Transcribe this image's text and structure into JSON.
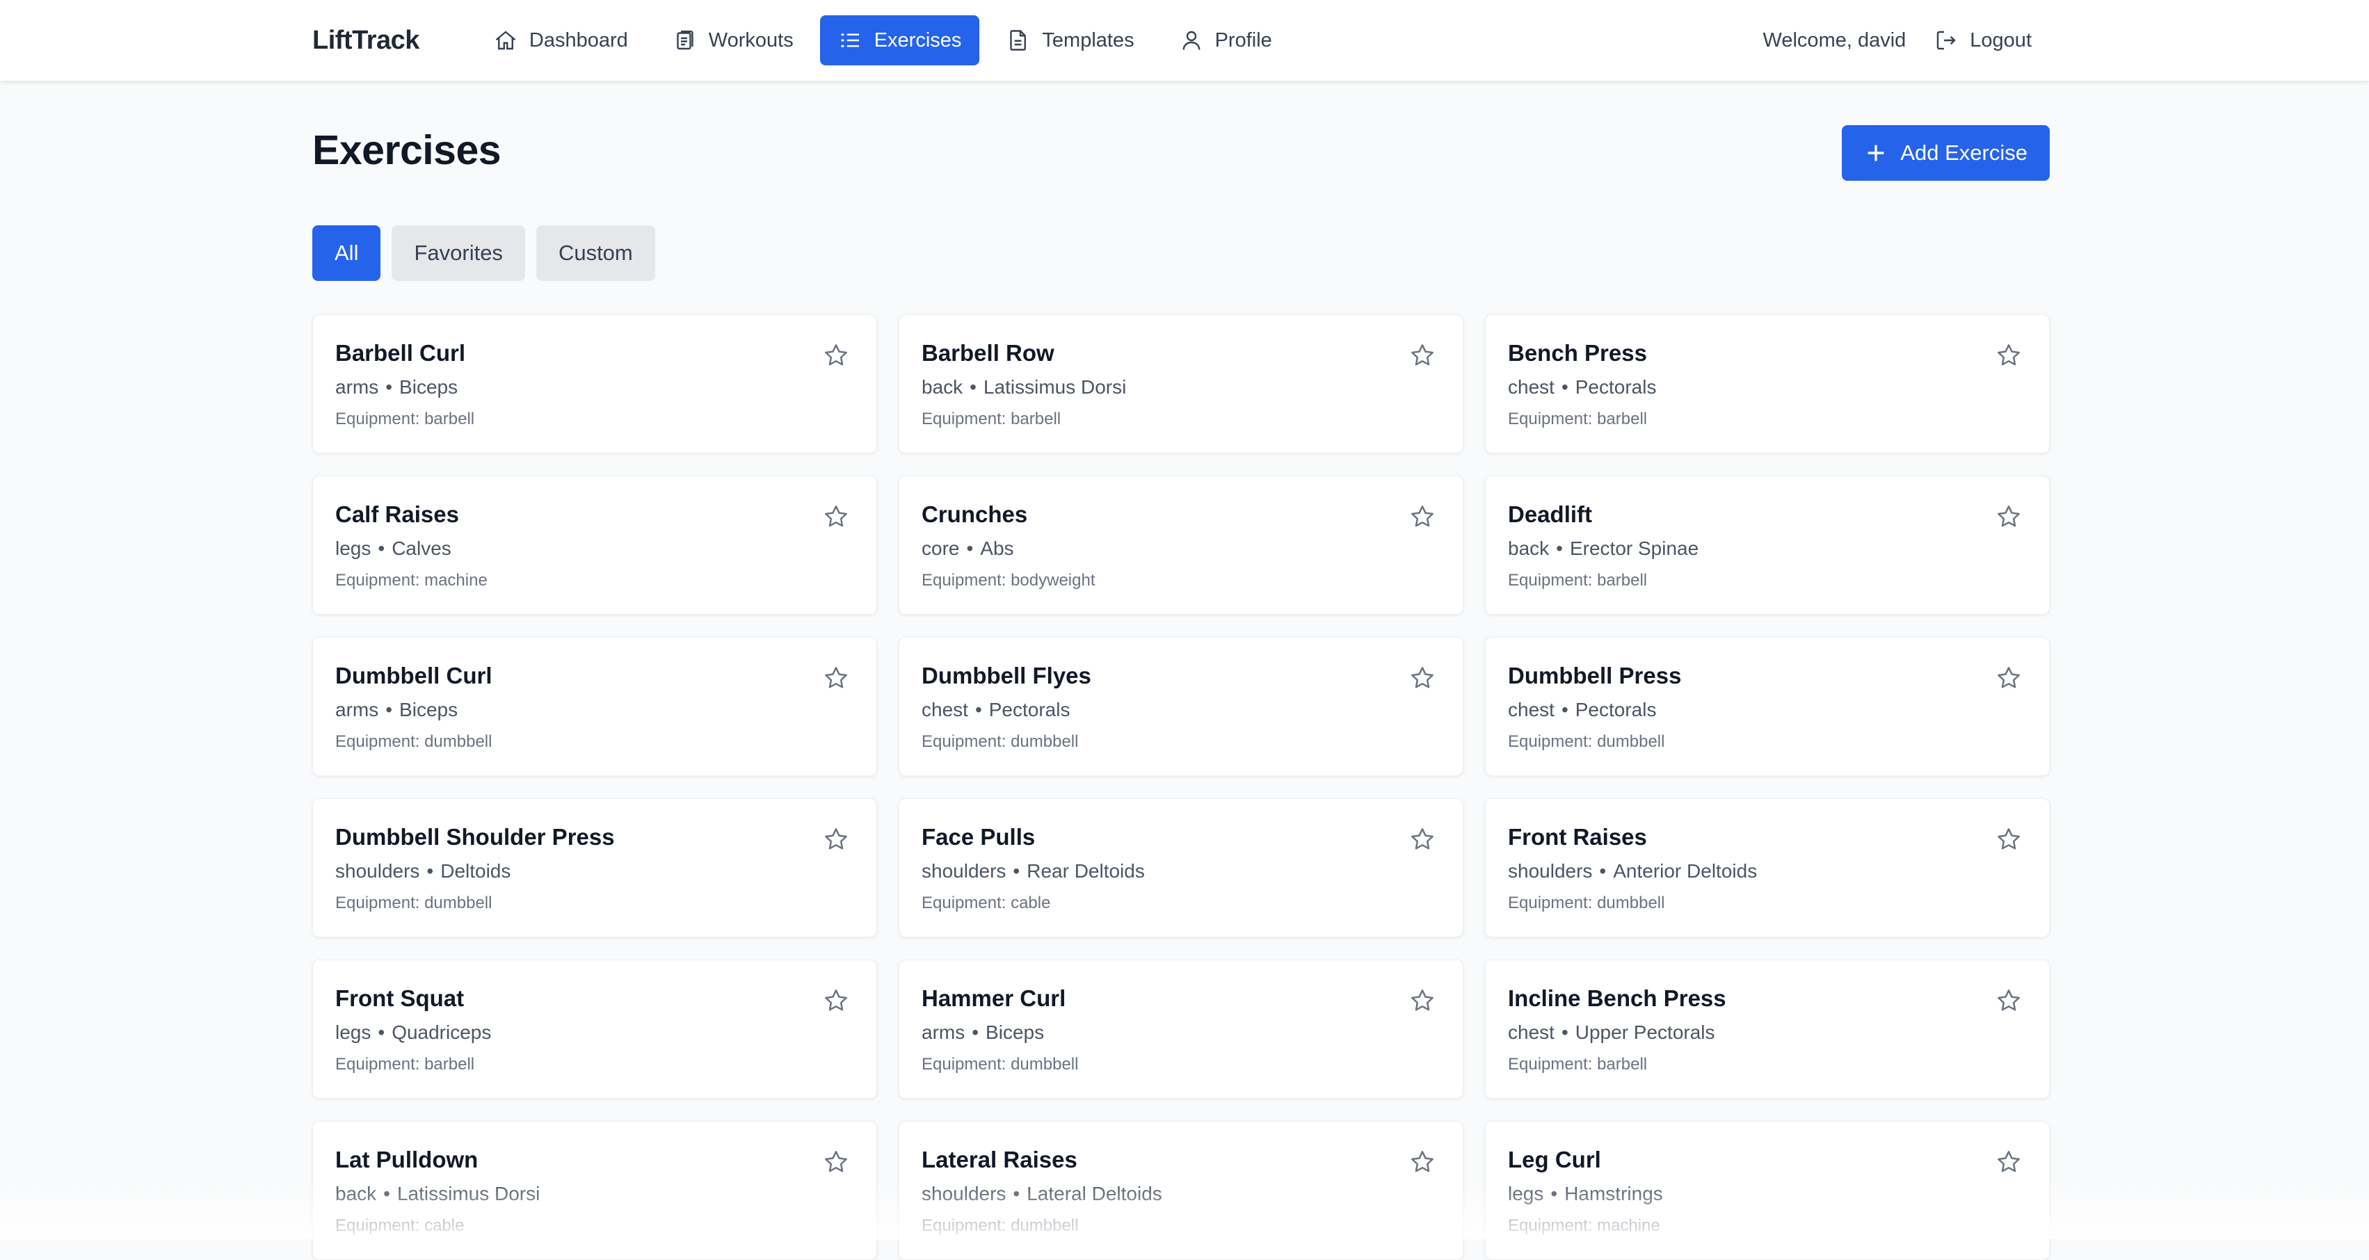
{
  "app": {
    "name": "LiftTrack"
  },
  "nav": {
    "items": [
      {
        "label": "Dashboard",
        "icon": "home-icon",
        "active": false
      },
      {
        "label": "Workouts",
        "icon": "clipboard-icon",
        "active": false
      },
      {
        "label": "Exercises",
        "icon": "list-icon",
        "active": true
      },
      {
        "label": "Templates",
        "icon": "document-icon",
        "active": false
      },
      {
        "label": "Profile",
        "icon": "user-icon",
        "active": false
      }
    ],
    "welcome": "Welcome, david",
    "logout_label": "Logout"
  },
  "page": {
    "title": "Exercises",
    "add_button_label": "Add Exercise"
  },
  "filters": [
    {
      "label": "All",
      "active": true
    },
    {
      "label": "Favorites",
      "active": false
    },
    {
      "label": "Custom",
      "active": false
    }
  ],
  "exercises": [
    {
      "name": "Barbell Curl",
      "category": "arms",
      "muscle": "Biceps",
      "equipment": "Equipment: barbell"
    },
    {
      "name": "Barbell Row",
      "category": "back",
      "muscle": "Latissimus Dorsi",
      "equipment": "Equipment: barbell"
    },
    {
      "name": "Bench Press",
      "category": "chest",
      "muscle": "Pectorals",
      "equipment": "Equipment: barbell"
    },
    {
      "name": "Calf Raises",
      "category": "legs",
      "muscle": "Calves",
      "equipment": "Equipment: machine"
    },
    {
      "name": "Crunches",
      "category": "core",
      "muscle": "Abs",
      "equipment": "Equipment: bodyweight"
    },
    {
      "name": "Deadlift",
      "category": "back",
      "muscle": "Erector Spinae",
      "equipment": "Equipment: barbell"
    },
    {
      "name": "Dumbbell Curl",
      "category": "arms",
      "muscle": "Biceps",
      "equipment": "Equipment: dumbbell"
    },
    {
      "name": "Dumbbell Flyes",
      "category": "chest",
      "muscle": "Pectorals",
      "equipment": "Equipment: dumbbell"
    },
    {
      "name": "Dumbbell Press",
      "category": "chest",
      "muscle": "Pectorals",
      "equipment": "Equipment: dumbbell"
    },
    {
      "name": "Dumbbell Shoulder Press",
      "category": "shoulders",
      "muscle": "Deltoids",
      "equipment": "Equipment: dumbbell"
    },
    {
      "name": "Face Pulls",
      "category": "shoulders",
      "muscle": "Rear Deltoids",
      "equipment": "Equipment: cable"
    },
    {
      "name": "Front Raises",
      "category": "shoulders",
      "muscle": "Anterior Deltoids",
      "equipment": "Equipment: dumbbell"
    },
    {
      "name": "Front Squat",
      "category": "legs",
      "muscle": "Quadriceps",
      "equipment": "Equipment: barbell"
    },
    {
      "name": "Hammer Curl",
      "category": "arms",
      "muscle": "Biceps",
      "equipment": "Equipment: dumbbell"
    },
    {
      "name": "Incline Bench Press",
      "category": "chest",
      "muscle": "Upper Pectorals",
      "equipment": "Equipment: barbell"
    },
    {
      "name": "Lat Pulldown",
      "category": "back",
      "muscle": "Latissimus Dorsi",
      "equipment": "Equipment: cable"
    },
    {
      "name": "Lateral Raises",
      "category": "shoulders",
      "muscle": "Lateral Deltoids",
      "equipment": "Equipment: dumbbell"
    },
    {
      "name": "Leg Curl",
      "category": "legs",
      "muscle": "Hamstrings",
      "equipment": "Equipment: machine"
    }
  ],
  "meta_separator": "•",
  "colors": {
    "accent": "#2563eb",
    "chip": "#e5e7eb",
    "background": "#f9fafb"
  }
}
